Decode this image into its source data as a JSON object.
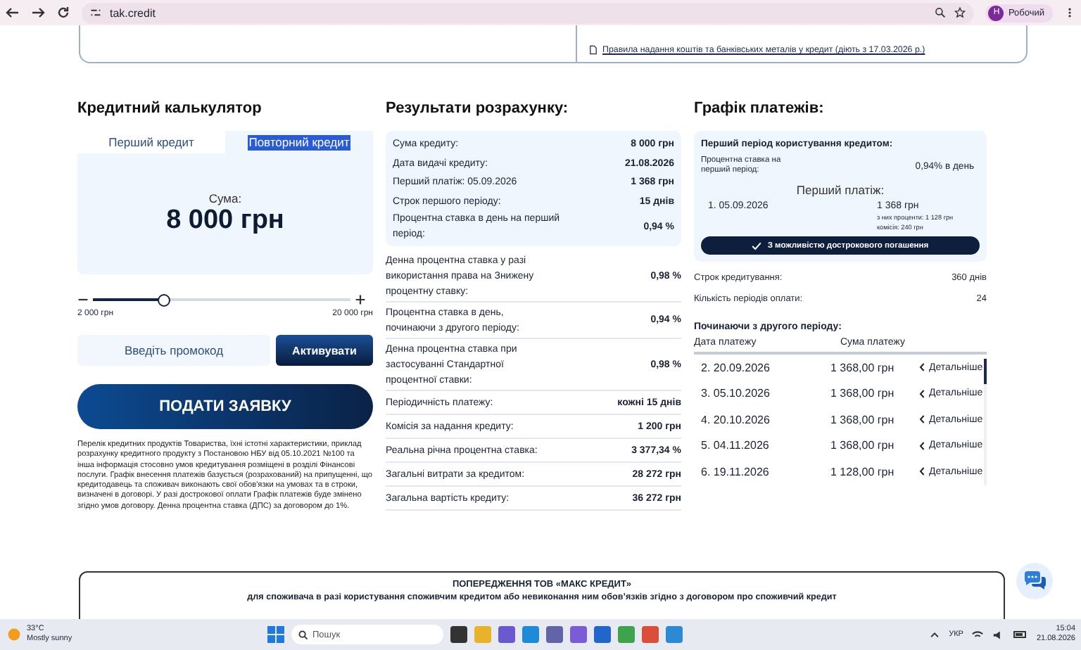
{
  "browser": {
    "url": "tak.credit",
    "profile": {
      "initial": "Н",
      "name": "Робочий"
    }
  },
  "notice_card": {
    "links": [
      {
        "text": "Правила надання коштів та банківських металів у кредит (діють з 17.03.2026 р.)"
      }
    ]
  },
  "calculator": {
    "title": "Кредитний калькулятор",
    "tabs": [
      {
        "label": "Перший кредит",
        "selected": false,
        "highlighted": false
      },
      {
        "label": "Повторний кредит",
        "selected": true,
        "highlighted": true
      }
    ],
    "amount_label": "Сума:",
    "amount": "8 000 грн",
    "slider": {
      "level": 0.28,
      "min_label": "2 000 грн",
      "max_label": "20 000 грн"
    },
    "promo": {
      "placeholder": "Введіть промокод"
    },
    "activate_button": "Активувати",
    "submit_button": "ПОДАТИ ЗАЯВКУ",
    "disclaimer": "Перелік кредитних продуктів Товариства, їхні істотні характеристики, приклад розрахунку кредитного продукту з Постановою НБУ від 05.10.2021 №100 та інша інформація стосовно умов кредитування розміщені в розділі Фінансові послуги. Графік внесення платежів базується (розрахований) на припущенні, що кредитодавець та споживач виконають свої обов'язки на умовах та в строки, визначені в договорі. У разі дострокової оплати Графік платежів буде змінено згідно умов договору. Денна процентна ставка (ДПС) за договором до 1%."
  },
  "results": {
    "title": "Результати розрахунку:",
    "summary": [
      {
        "label": "Сума кредиту:",
        "value": "8 000 грн"
      },
      {
        "label": "Дата видачі кредиту:",
        "value": "21.08.2026"
      },
      {
        "label": "Перший платіж: 05.09.2026",
        "value": "1 368 грн"
      },
      {
        "label": "Строк першого періоду:",
        "value": "15 днів"
      },
      {
        "label": "Процентна ставка в день на перший період:",
        "value": "0,94 %"
      }
    ],
    "rows": [
      {
        "label": "Денна процентна ставка у разі використання права на Знижену процентну ставку:",
        "value": "0,98 %"
      },
      {
        "label": "Процентна ставка в день, починаючи з другого періоду:",
        "value": "0,94 %"
      },
      {
        "label": "Денна процентна ставка при застосуванні Стандартної процентної ставки:",
        "value": "0,98 %"
      },
      {
        "label": "Періодичність платежу:",
        "value": "кожні 15 днів"
      },
      {
        "label": "Комісія за надання кредиту:",
        "value": "1 200 грн"
      },
      {
        "label": "Реальна річна процентна ставка:",
        "value": "3 377,34 %"
      },
      {
        "label": "Загальні витрати за кредитом:",
        "value": "28 272 грн"
      },
      {
        "label": "Загальна вартість кредиту:",
        "value": "36 272 грн"
      }
    ]
  },
  "schedule": {
    "title": "Графік платежів:",
    "first_period": {
      "title": "Перший період користування кредитом:",
      "rate_label": "Процентна ставка на перший період:",
      "rate_value": "0,94% в день",
      "payment_title": "Перший платіж:",
      "payment_date": "1. 05.09.2026",
      "payment_amount": "1 368 грн",
      "interest_note": "з них проценти: 1 128 грн",
      "fee_note": "комісія: 240 грн",
      "badge": "З можливістю дострокового погашення"
    },
    "info": [
      {
        "label": "Строк кредитування:",
        "value": "360 днів"
      },
      {
        "label": "Кількість періодів оплати:",
        "value": "24"
      }
    ],
    "subtitle": "Починаючи з другого періоду:",
    "columns": [
      "Дата платежу",
      "Сума платежу"
    ],
    "rows": [
      {
        "date": "2. 20.09.2026",
        "amount": "1 368,00 грн",
        "action": "Детальніше"
      },
      {
        "date": "3. 05.10.2026",
        "amount": "1 368,00 грн",
        "action": "Детальніше"
      },
      {
        "date": "4. 20.10.2026",
        "amount": "1 368,00 грн",
        "action": "Детальніше"
      },
      {
        "date": "5. 04.11.2026",
        "amount": "1 368,00 грн",
        "action": "Детальніше"
      },
      {
        "date": "6. 19.11.2026",
        "amount": "1 128,00 грн",
        "action": "Детальніше"
      }
    ]
  },
  "warning": {
    "title": "ПОПЕРЕДЖЕННЯ ТОВ «МАКС КРЕДИТ»",
    "subtitle": "для споживача в разі користування споживчим кредитом або невиконання ним обов’язків згідно з договором про споживчий кредит"
  },
  "taskbar": {
    "weather": {
      "temp": "33°C",
      "condition": "Mostly sunny"
    },
    "search_placeholder": "Пошук",
    "language": "УКР",
    "time": "15:04",
    "date": "21.08.2026"
  }
}
